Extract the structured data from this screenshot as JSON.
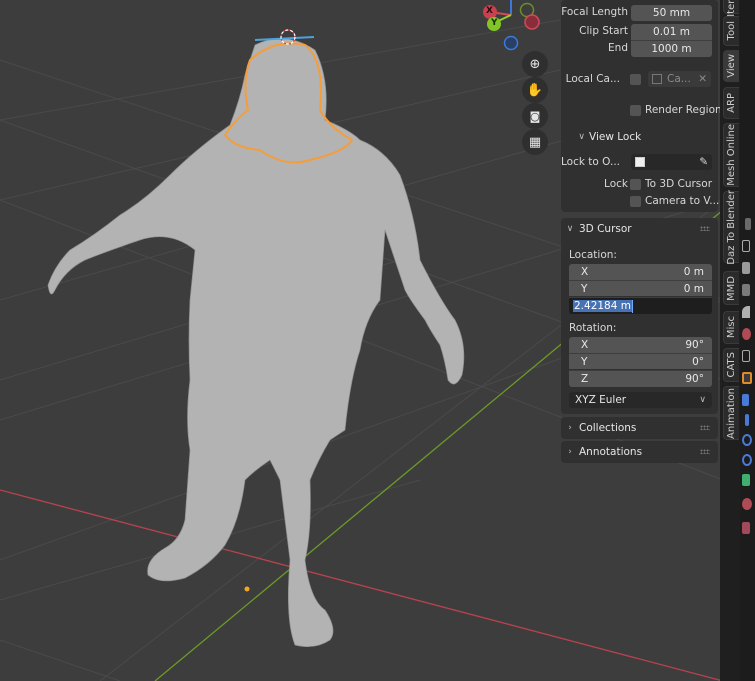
{
  "viewport": {
    "gizmo": {
      "x_label": "X",
      "y_label": "Y",
      "x_color": "#d14a5c",
      "y_color": "#8fd12a",
      "z_color": "#3b7ad8"
    },
    "nav_buttons": [
      {
        "name": "zoom-icon",
        "glyph": "🔍"
      },
      {
        "name": "pan-hand-icon",
        "glyph": "✋"
      },
      {
        "name": "camera-view-icon",
        "glyph": "🎥"
      },
      {
        "name": "perspective-grid-icon",
        "glyph": "▦"
      }
    ],
    "colors": {
      "grid_x_axis": "#b8434f",
      "grid_y_axis": "#6a9a27",
      "selection_outline": "#f59d3b",
      "mesh": "#b5b5b5"
    }
  },
  "view_panel": {
    "focal_length_label": "Focal Length",
    "focal_length_value": "50 mm",
    "clip_start_label": "Clip Start",
    "clip_start_value": "0.01 m",
    "clip_end_label": "End",
    "clip_end_value": "1000 m",
    "local_camera_label": "Local Ca...",
    "local_camera_value": "Ca...",
    "render_region_label": "Render Region",
    "view_lock_title": "View Lock",
    "lock_to_object_label": "Lock to O...",
    "lock_label": "Lock",
    "to_3d_cursor_label": "To 3D Cursor",
    "camera_to_view_label": "Camera to V..."
  },
  "cursor_panel": {
    "title": "3D Cursor",
    "location_label": "Location:",
    "location": [
      {
        "axis": "X",
        "value": "0 m"
      },
      {
        "axis": "Y",
        "value": "0 m"
      }
    ],
    "location_z_editing": "2.42184 m",
    "rotation_label": "Rotation:",
    "rotation": [
      {
        "axis": "X",
        "value": "90°"
      },
      {
        "axis": "Y",
        "value": "0°"
      },
      {
        "axis": "Z",
        "value": "90°"
      }
    ],
    "rotation_mode": "XYZ Euler"
  },
  "collections_title": "Collections",
  "annotations_title": "Annotations",
  "tabs": [
    "Item",
    "Tool",
    "View",
    "ARP",
    "Mesh Online",
    "Daz To Blender",
    "MMD",
    "Misc",
    "CATS",
    "Animation"
  ],
  "active_tab": "View"
}
